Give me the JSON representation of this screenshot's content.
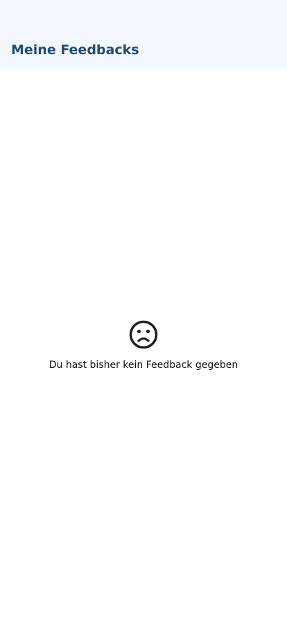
{
  "header": {
    "title": "Meine Feedbacks"
  },
  "empty_state": {
    "icon": "sad-face-icon",
    "message": "Du hast bisher kein Feedback gegeben"
  },
  "colors": {
    "header_background": "#f3f8ff",
    "title": "#234a72",
    "icon": "#1f1f1f",
    "text": "#111111"
  }
}
